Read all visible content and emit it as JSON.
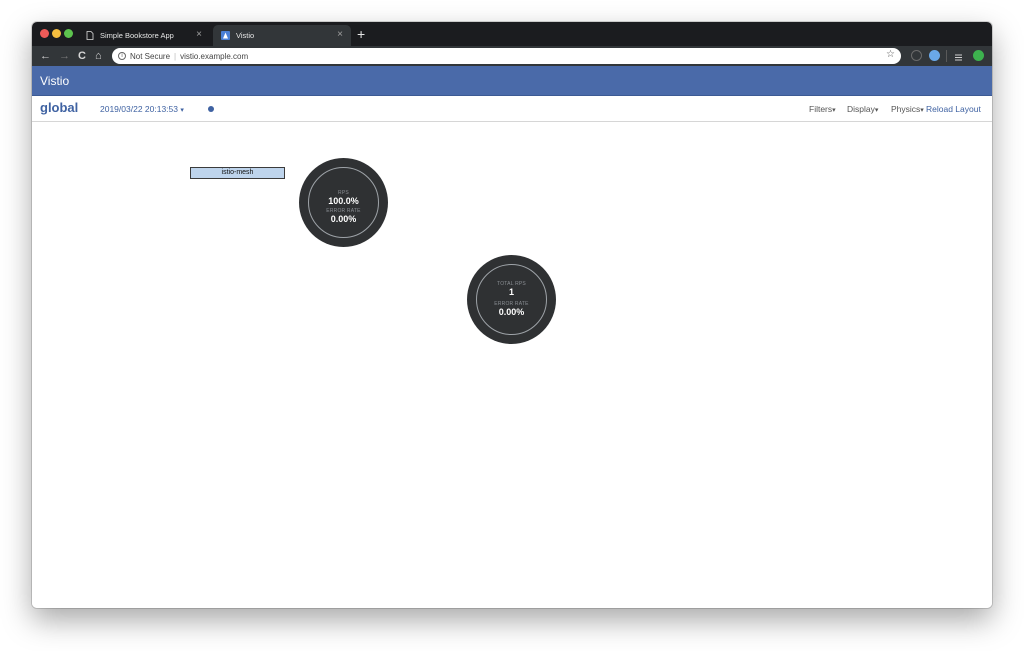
{
  "browser": {
    "tabs": [
      {
        "title": "Simple Bookstore App",
        "icon": "page-icon",
        "active": false
      },
      {
        "title": "Vistio",
        "icon": "vistio-favicon",
        "active": true
      }
    ],
    "close_glyph": "×",
    "new_tab_glyph": "+",
    "nav": {
      "back": "←",
      "forward": "→",
      "reload": "C",
      "home": "⌂"
    },
    "security_label": "Not Secure",
    "url": "vistio.example.com",
    "separator": "|",
    "bookmark_glyph": "☆"
  },
  "app": {
    "title": "Vistio",
    "view": "global",
    "timestamp": "2019/03/22 20:13:53",
    "menus": {
      "filters": "Filters",
      "display": "Display",
      "physics": "Physics",
      "reload": "Reload Layout"
    },
    "caret": "▾",
    "colors": {
      "header": "#4a6aa9",
      "accent": "#3f62a2",
      "node": "#2f3133",
      "cluster_label_bg": "#bed4ec"
    }
  },
  "graph": {
    "cluster_label": "istio-mesh",
    "nodes": [
      {
        "primary_label": "RPS",
        "primary_value": "100.0%",
        "secondary_label": "ERROR RATE",
        "secondary_value": "0.00%"
      },
      {
        "primary_label": "TOTAL RPS",
        "primary_value": "1",
        "secondary_label": "ERROR RATE",
        "secondary_value": "0.00%"
      }
    ]
  }
}
